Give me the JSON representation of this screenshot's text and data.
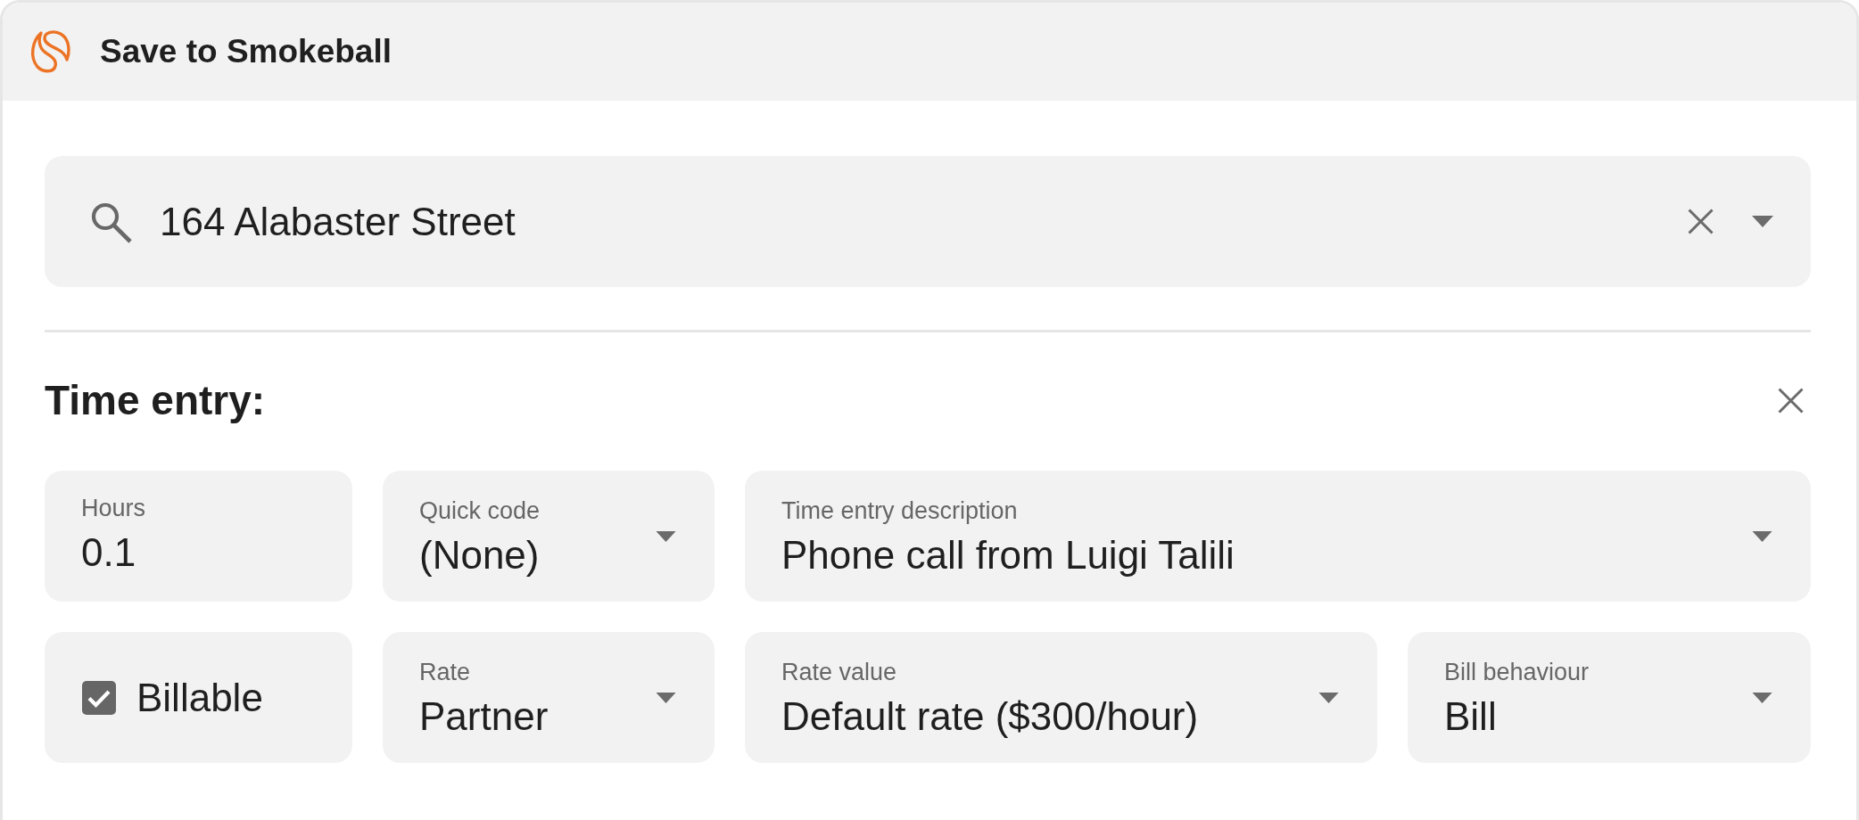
{
  "window": {
    "title": "Save to Smokeball"
  },
  "search": {
    "value": "164 Alabaster Street"
  },
  "time_entry": {
    "title": "Time entry:",
    "rows": [
      [
        {
          "kind": "text",
          "label": "Hours",
          "value": "0.1"
        },
        {
          "kind": "select",
          "label": "Quick code",
          "value": "(None)"
        },
        {
          "kind": "select",
          "label": "Time entry description",
          "value": "Phone call from Luigi Talili"
        }
      ],
      [
        {
          "kind": "checkbox",
          "label": "Billable",
          "checked": true
        },
        {
          "kind": "select",
          "label": "Rate",
          "value": "Partner"
        },
        {
          "kind": "select",
          "label": "Rate value",
          "value": "Default rate ($300/hour)"
        },
        {
          "kind": "select",
          "label": "Bill behaviour",
          "value": "Bill"
        }
      ]
    ]
  }
}
